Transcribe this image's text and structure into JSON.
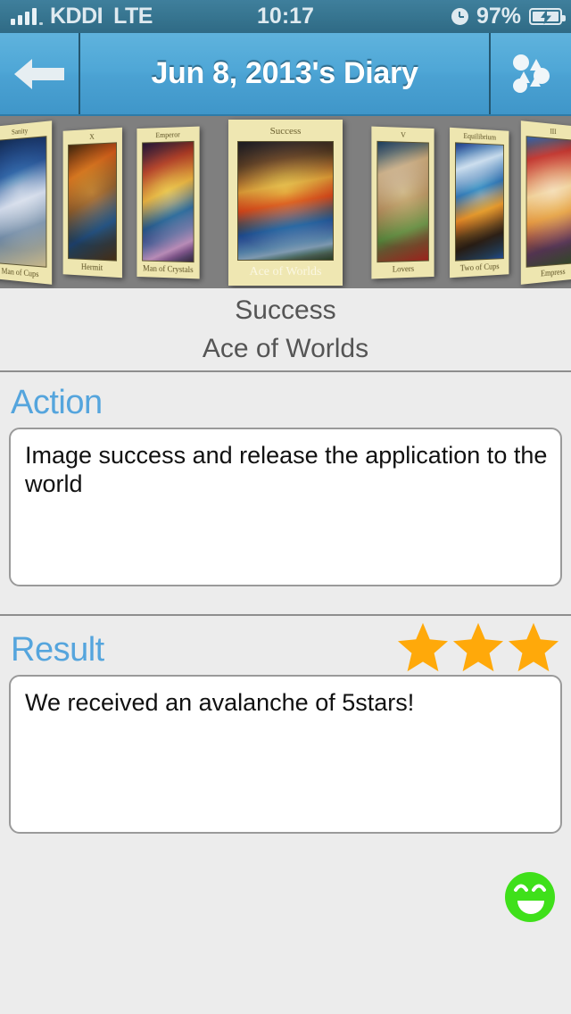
{
  "status_bar": {
    "carrier": "KDDI",
    "network": "LTE",
    "time": "10:17",
    "battery_percent": "97%",
    "signal_icon": "signal-bars-icon",
    "alarm_icon": "alarm-clock-icon",
    "battery_icon": "battery-charging-icon"
  },
  "nav_bar": {
    "title": "Jun 8, 2013's Diary",
    "back_icon": "back-arrow-icon",
    "menu_icon": "cards-cluster-icon"
  },
  "carousel": {
    "background_color": "#7f7f7f",
    "cards": [
      {
        "keyword": "Sanity",
        "name": "Man of Cups",
        "art": "a-cups",
        "selected": false
      },
      {
        "keyword": "X",
        "name": "Hermit",
        "art": "a-hermit",
        "selected": false
      },
      {
        "keyword": "Emperor",
        "name": "Man of Crystals",
        "art": "a-crystal",
        "selected": false
      },
      {
        "keyword": "Success",
        "name": "Ace of Worlds",
        "art": "a-worlds",
        "selected": true
      },
      {
        "keyword": "V",
        "name": "Lovers",
        "art": "a-lovers",
        "selected": false
      },
      {
        "keyword": "Equilibrium",
        "name": "Two of Cups",
        "art": "a-twocups",
        "selected": false
      },
      {
        "keyword": "III",
        "name": "Empress",
        "art": "a-empress",
        "selected": false
      }
    ]
  },
  "card_info": {
    "keyword": "Success",
    "name": "Ace of Worlds"
  },
  "action": {
    "title": "Action",
    "text": "Image success and release the application to the world",
    "placeholder": ""
  },
  "result": {
    "title": "Result",
    "text": "We received an avalanche of 5stars!",
    "placeholder": "",
    "stars_filled": 3,
    "star_color": "#FFA90A"
  },
  "mood": {
    "icon": "happy-face-icon",
    "color": "#3FE01A"
  },
  "colors": {
    "accent": "#55a5dd",
    "nav_bar": "#4ba2d3",
    "status_bar": "#36748f",
    "page_background": "#ececec"
  }
}
